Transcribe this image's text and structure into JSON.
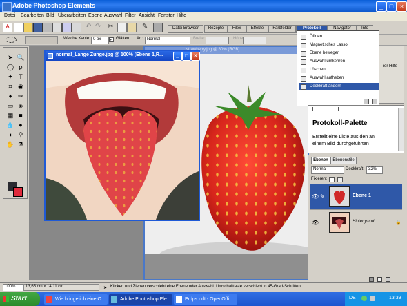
{
  "window": {
    "title": "Adobe Photoshop Elements",
    "controls": [
      "_",
      "□",
      "×"
    ]
  },
  "menubar": [
    "Datei",
    "Bearbeiten",
    "Bild",
    "Überarbeiten",
    "Ebene",
    "Auswahl",
    "Filter",
    "Ansicht",
    "Fenster",
    "Hilfe"
  ],
  "palette_tabs": [
    "Datei-Browser",
    "Rezepte",
    "Filter",
    "Effekte",
    "Farbfelder",
    "Protokoll",
    "Navigator",
    "Info"
  ],
  "options": {
    "soft_edge_label": "Weiche Kante:",
    "soft_edge_value": "0 px",
    "smooth_label": "Glätten",
    "style_label": "Art:",
    "style_value": "Normal",
    "width_label": "Breite:",
    "height_label": "Höhe:"
  },
  "documents": {
    "front_title": "normal_Lange Zunge.jpg @ 100% (Ebene 1,R...",
    "back_title": "strawberry.jpg @ 80% (RGB)"
  },
  "protocol_menu": {
    "items": [
      "Öffnen",
      "Magnetisches Lasso",
      "Ebene bewegen",
      "Auswahl umkehren",
      "Löschen",
      "Auswahl aufheben",
      "Deckkraft ändern"
    ],
    "selected_index": 6
  },
  "help_panel": {
    "header_fragment": "rer Hilfe",
    "title": "Protokoll-Palette",
    "text_line1": "Erstellt eine Liste aus den an",
    "text_line2": "einem Bild durchgeführten"
  },
  "layers_panel": {
    "tabs": [
      "Ebenen",
      "Ebenenstile"
    ],
    "blend_mode": "Normal",
    "opacity_label": "Deckkraft:",
    "opacity_value": "32%",
    "lock_label": "Fixieren:",
    "layers": [
      {
        "name": "Ebene 1",
        "selected": true
      },
      {
        "name": "Hintergrund",
        "selected": false
      }
    ]
  },
  "statusbar": {
    "zoom": "100%",
    "doc_size": "13,65 cm x 14,11 cm",
    "hint": "Klicken und Ziehen verschiebt eine Ebene oder Auswahl. Umschalttaste verschiebt in 45-Grad-Schritten."
  },
  "taskbar": {
    "start_label": "Start",
    "tasks": [
      "Wie bringe ich eine O...",
      "Adobe Photoshop Ele...",
      "Erdps.odt - OpenOffi..."
    ],
    "active_index": 1,
    "tray": {
      "lang": "DE",
      "time": "13:39"
    }
  },
  "colors": {
    "title_blue": "#1446c4",
    "selection_blue": "#2f58a8",
    "strawberry_red": "#d8261c"
  }
}
